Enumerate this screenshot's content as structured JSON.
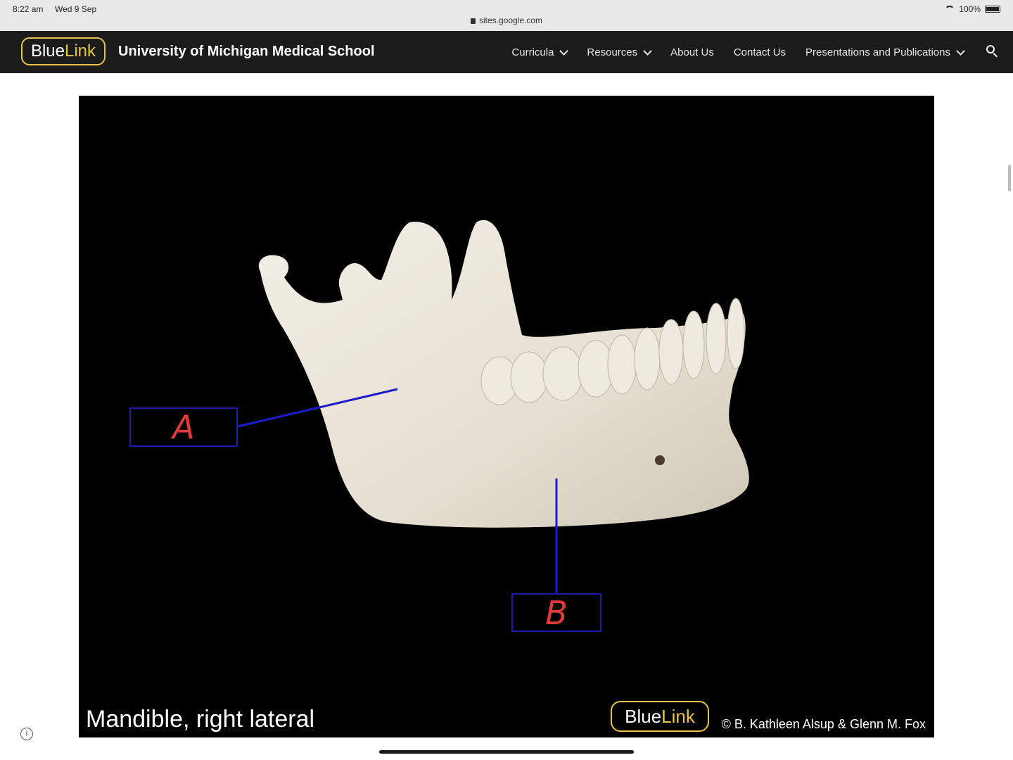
{
  "statusbar": {
    "time": "8:22 am",
    "date": "Wed 9 Sep",
    "url": "sites.google.com",
    "battery": "100%"
  },
  "header": {
    "logo_blue": "Blue",
    "logo_link": "Link",
    "site_name": "University of Michigan Medical School",
    "nav": {
      "curricula": "Curricula",
      "resources": "Resources",
      "about": "About Us",
      "contact": "Contact Us",
      "presentations": "Presentations and Publications"
    }
  },
  "figure": {
    "caption": "Mandible, right lateral",
    "watermark_blue": "Blue",
    "watermark_link": "Link",
    "copyright": "© B. Kathleen Alsup & Glenn M. Fox",
    "labels": {
      "a": "A",
      "b": "B"
    }
  },
  "colors": {
    "accent": "#e8c34a",
    "header_bg": "#1b1b1b",
    "label_box": "#1c1ca8",
    "label_text": "#e23a3a",
    "bone": "#e9e4d8"
  }
}
